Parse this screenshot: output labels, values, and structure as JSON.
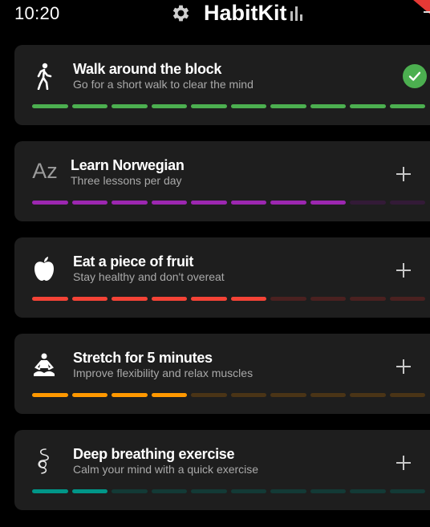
{
  "status_bar": {
    "time": "10:20"
  },
  "header": {
    "title": "HabitKit",
    "settings_icon": "gear-icon",
    "stats_icon": "bar-chart-icon"
  },
  "habits": [
    {
      "name": "Walk around the block",
      "description": "Go for a short walk to clear the mind",
      "icon": "walking-person-icon",
      "color": "#4caf50",
      "dim_color": "#1b3a1d",
      "completed_segments": 10,
      "total_segments": 10,
      "action": "completed-check",
      "done_today": true
    },
    {
      "name": "Learn Norwegian",
      "description": "Three lessons per day",
      "icon": "language-az-icon",
      "icon_text": "Az",
      "color": "#9c27b0",
      "dim_color": "#331a37",
      "completed_segments": 8,
      "total_segments": 10,
      "action": "add",
      "done_today": false
    },
    {
      "name": "Eat a piece of fruit",
      "description": "Stay healthy and don't overeat",
      "icon": "apple-icon",
      "color": "#f44336",
      "dim_color": "#4a2120",
      "completed_segments": 6,
      "total_segments": 10,
      "action": "add",
      "done_today": false
    },
    {
      "name": "Stretch for 5 minutes",
      "description": "Improve flexibility and relax muscles",
      "icon": "meditation-icon",
      "color": "#ff9800",
      "dim_color": "#4a3416",
      "completed_segments": 4,
      "total_segments": 10,
      "action": "add",
      "done_today": false
    },
    {
      "name": "Deep breathing exercise",
      "description": "Calm your mind with a quick exercise",
      "icon": "breathing-lungs-icon",
      "color": "#009688",
      "dim_color": "#133a36",
      "completed_segments": 2,
      "total_segments": 10,
      "action": "add",
      "done_today": false
    }
  ]
}
